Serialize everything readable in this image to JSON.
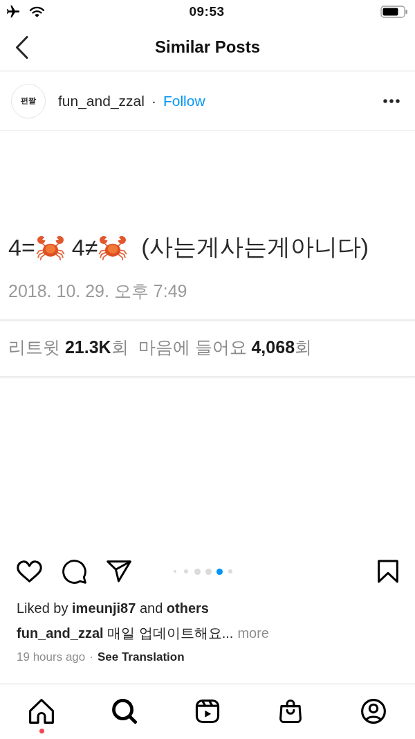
{
  "status_bar": {
    "time": "09:53"
  },
  "header": {
    "title": "Similar Posts"
  },
  "post": {
    "author": {
      "avatar_text": "편짤",
      "username": "fun_and_zzal",
      "separator": "·",
      "follow": "Follow"
    },
    "tweet": {
      "line": [
        {
          "kind": "text",
          "text": "4="
        },
        {
          "kind": "crab"
        },
        {
          "kind": "text",
          "text": "4≠"
        },
        {
          "kind": "crab"
        },
        {
          "kind": "text",
          "text": "(사는게사는게아니다)"
        }
      ],
      "date": "2018. 10. 29. 오후 7:49",
      "stats": "리트윗 **21.3K**회  마음에 들어요 **4,068**회"
    },
    "carousel": [
      {
        "selected": false
      },
      {
        "selected": false
      },
      {
        "selected": false
      },
      {
        "selected": false
      },
      {
        "selected": true
      },
      {
        "selected": false
      }
    ],
    "likes": "Liked by **imeunji87** and **others**",
    "caption": {
      "text": "**fun_and_zzal** 매일 업데이트해요...",
      "more": "more"
    },
    "time": "19 hours ago",
    "separator": "·",
    "translation": "See Translation"
  },
  "tab_bar": [
    {
      "kind": "home",
      "selected": false,
      "dot": true
    },
    {
      "kind": "search",
      "selected": true,
      "dot": false
    },
    {
      "kind": "reels",
      "selected": false,
      "dot": false
    },
    {
      "kind": "shop",
      "selected": false,
      "dot": false
    },
    {
      "kind": "profile",
      "selected": false,
      "dot": false
    }
  ]
}
